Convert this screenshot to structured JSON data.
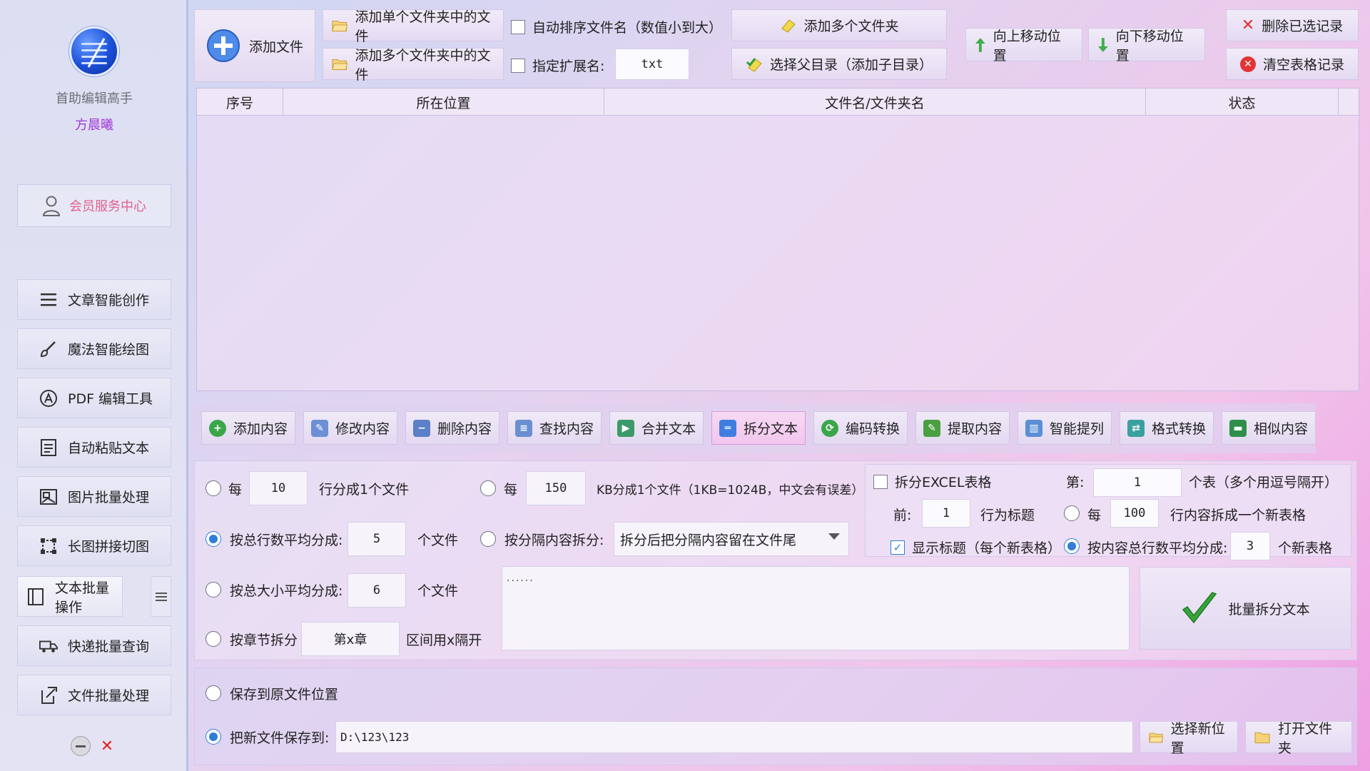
{
  "app": {
    "name": "首助编辑高手",
    "author": "方晨曦"
  },
  "sidebar": {
    "member_label": "会员服务中心",
    "items": [
      {
        "label": "文章智能创作",
        "icon": "list-lines-icon"
      },
      {
        "label": "魔法智能绘图",
        "icon": "paint-brush-icon"
      },
      {
        "label": "PDF 编辑工具",
        "icon": "pdf-icon"
      },
      {
        "label": "自动粘贴文本",
        "icon": "paste-doc-icon"
      },
      {
        "label": "图片批量处理",
        "icon": "image-icon"
      },
      {
        "label": "长图拼接切图",
        "icon": "crop-icon"
      },
      {
        "label": "文本批量操作",
        "icon": "text-panel-icon",
        "active": true
      },
      {
        "label": "快递批量查询",
        "icon": "truck-icon"
      },
      {
        "label": "文件批量处理",
        "icon": "file-edit-icon"
      }
    ]
  },
  "toolbar": {
    "add_file": "添加文件",
    "add_single_folder_files": "添加单个文件夹中的文件",
    "add_multi_folder_files": "添加多个文件夹中的文件",
    "auto_sort": "自动排序文件名（数值小到大）",
    "specify_ext": "指定扩展名:",
    "ext_value": "txt",
    "add_multi_folders": "添加多个文件夹",
    "select_parent_dir": "选择父目录（添加子目录）",
    "move_up": "向上移动位置",
    "move_down": "向下移动位置",
    "delete_selected": "删除已选记录",
    "clear_table": "清空表格记录"
  },
  "table": {
    "columns": [
      "序号",
      "所在位置",
      "文件名/文件夹名",
      "状态"
    ],
    "rows": []
  },
  "tabs": [
    {
      "label": "添加内容",
      "color": "#3aa64a"
    },
    {
      "label": "修改内容",
      "color": "#6c8fd6"
    },
    {
      "label": "删除内容",
      "color": "#5b7fc9"
    },
    {
      "label": "查找内容",
      "color": "#6a8fd0"
    },
    {
      "label": "合并文本",
      "color": "#3c9a6a"
    },
    {
      "label": "拆分文本",
      "color": "#3f7ee0",
      "active": true
    },
    {
      "label": "编码转换",
      "color": "#3aa64a"
    },
    {
      "label": "提取内容",
      "color": "#4aa040"
    },
    {
      "label": "智能提列",
      "color": "#5a8fd6"
    },
    {
      "label": "格式转换",
      "color": "#3aa0a0"
    },
    {
      "label": "相似内容",
      "color": "#2f8f4a"
    }
  ],
  "split": {
    "every_lines_prefix": "每",
    "every_lines_value": "10",
    "every_lines_suffix": "行分成1个文件",
    "every_kb_prefix": "每",
    "every_kb_value": "150",
    "every_kb_suffix": "KB分成1个文件（1KB=1024B，中文会有误差）",
    "by_total_lines": "按总行数平均分成:",
    "by_total_lines_value": "5",
    "files_unit": "个文件",
    "by_separator": "按分隔内容拆分:",
    "separator_option": "拆分后把分隔内容留在文件尾",
    "by_total_size": "按总大小平均分成:",
    "by_total_size_value": "6",
    "by_chapter": "按章节拆分",
    "chapter_value": "第x章",
    "chapter_note": "区间用x隔开",
    "separator_text": "......",
    "excel_split": "拆分EXCEL表格",
    "sheet_prefix": "第:",
    "sheet_value": "1",
    "sheet_suffix": "个表（多个用逗号隔开）",
    "front_prefix": "前:",
    "front_value": "1",
    "front_suffix": "行为标题",
    "every_rows_prefix": "每",
    "every_rows_value": "100",
    "every_rows_suffix": "行内容拆成一个新表格",
    "show_title": "显示标题（每个新表格）",
    "by_content_rows": "按内容总行数平均分成:",
    "by_content_rows_value": "3",
    "new_tables_unit": "个新表格",
    "run_button": "批量拆分文本"
  },
  "save": {
    "save_original": "保存到原文件位置",
    "save_new": "把新文件保存到:",
    "path": "D:\\123\\123",
    "choose_location": "选择新位置",
    "open_folder": "打开文件夹"
  }
}
